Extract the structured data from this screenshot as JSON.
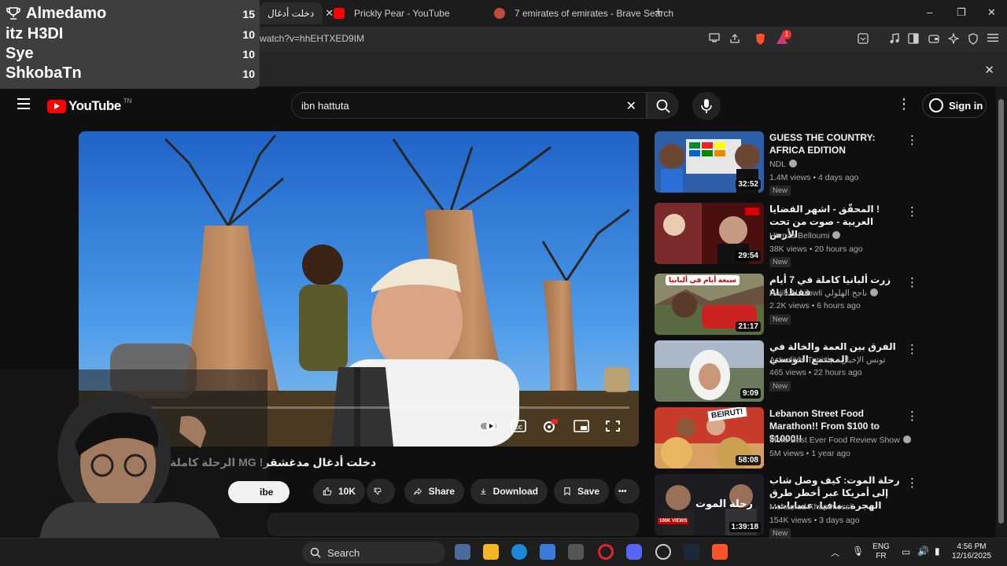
{
  "browser": {
    "tabs": [
      {
        "label": "دخلت أدغال",
        "active": true
      },
      {
        "label": "Prickly Pear - YouTube",
        "active": false
      },
      {
        "label": "7 emirates of emirates - Brave Search",
        "active": false
      }
    ],
    "close_tab_glyph": "✕",
    "new_tab_glyph": "+",
    "url": "watch?v=hhEHTXED9IM",
    "brave_badge": "1",
    "window_controls": [
      "–",
      "❐",
      "✕"
    ],
    "infobar_close": "✕"
  },
  "youtube": {
    "logo_text": "YouTube",
    "logo_country": "TN",
    "search_value": "ibn hattuta",
    "clear_glyph": "✕",
    "more_glyph": "⋮",
    "signin_label": "Sign in"
  },
  "video": {
    "title": "الرحلة كاملة MG !دخلت أدغال مدغشقر",
    "actions": {
      "like_count": "10K",
      "share_label": "Share",
      "download_label": "Download",
      "save_label": "Save",
      "more_glyph": "•••"
    },
    "subscribe_partial": "ibe"
  },
  "recommendations": [
    {
      "title": "GUESS THE COUNTRY: AFRICA EDITION",
      "channel": "NDL",
      "verified": true,
      "meta": "1.4M views • 4 days ago",
      "badge": "New",
      "duration": "32:52"
    },
    {
      "title": "! المحقّق - اشهر القضايا العربية - صوت من تحت الأرض",
      "channel": "Hamza Belloumi",
      "verified": true,
      "meta": "38K views • 20 hours ago",
      "badge": "New",
      "duration": "29:54"
    },
    {
      "title": "زرت ألبانيا كاملة في 7 أيام فقط! AL",
      "channel": "Najih Al hilowli ناجح الهلولي",
      "verified": true,
      "meta": "2.2K views • 6 hours ago",
      "badge": "New",
      "duration": "21:17"
    },
    {
      "title": "الفرق بين العمة والخالة في المجتمع التونسي",
      "channel": "Actualités Tunisie تونس الإخبارية",
      "verified": false,
      "meta": "465 views • 22 hours ago",
      "badge": "New",
      "duration": "9:09"
    },
    {
      "title": "Lebanon Street Food Marathon!! From $100 to $1000!!",
      "channel": "More Best Ever Food Review Show",
      "verified": true,
      "meta": "5M views • 1 year ago",
      "badge": "",
      "duration": "58:08"
    },
    {
      "title": "رحلة الموت: كيف وصل شاب إلى أمريكا عبر أخطر طرق الهجرة...مافيا، عصابات...",
      "channel": "Mohamed Khammessi",
      "verified": false,
      "meta": "154K views • 3 days ago",
      "badge": "New",
      "duration": "1:39:18"
    }
  ],
  "thumb_text": {
    "beirut": "BEIRUT!",
    "albania": "سبعة أيام في ألبانيا",
    "rehla": "رحلة الموت",
    "views_badge": "100K VIEWS"
  },
  "leaderboard": {
    "rows": [
      {
        "name": "Almedamo",
        "score": "15",
        "trophy": true
      },
      {
        "name": "itz H3DI",
        "score": "10",
        "trophy": false
      },
      {
        "name": "Sye",
        "score": "10",
        "trophy": false
      },
      {
        "name": "ShkobaTn",
        "score": "10",
        "trophy": false
      }
    ]
  },
  "taskbar": {
    "search_label": "Search",
    "language": "ENG",
    "layout": "FR",
    "time": "4:56 PM",
    "date": "12/16/2025"
  },
  "colors": {
    "youtube_red": "#ff0000",
    "background": "#0f0f0f",
    "chip": "#272727"
  }
}
